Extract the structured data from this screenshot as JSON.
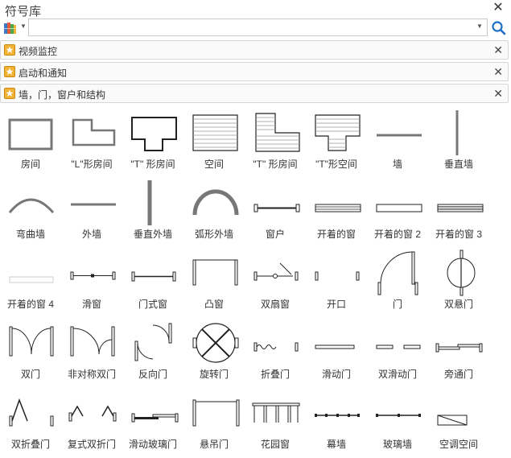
{
  "window": {
    "title": "符号库"
  },
  "search": {
    "value": "",
    "placeholder": ""
  },
  "libraries": [
    {
      "label": "视频监控"
    },
    {
      "label": "启动和通知"
    },
    {
      "label": "墙，门，窗户和结构"
    }
  ],
  "shapes": [
    "房间",
    "\"L\"形房间",
    "\"T\" 形房间",
    "空间",
    "\"T\" 形房间",
    "\"T\"形空间",
    "墙",
    "垂直墙",
    "弯曲墙",
    "外墙",
    "垂直外墙",
    "弧形外墙",
    "窗户",
    "开着的窗",
    "开着的窗 2",
    "开着的窗 3",
    "开着的窗 4",
    "滑窗",
    "门式窗",
    "凸窗",
    "双扇窗",
    "开口",
    "门",
    "双悬门",
    "双门",
    "非对称双门",
    "反向门",
    "旋转门",
    "折叠门",
    "滑动门",
    "双滑动门",
    "旁通门",
    "双折叠门",
    "复式双折门",
    "滑动玻璃门",
    "悬吊门",
    "花园窗",
    "幕墙",
    "玻璃墙",
    "空调空间"
  ],
  "icons": {
    "library": "library-books-icon",
    "search": "magnifier-icon",
    "star": "star-tile-icon",
    "close": "close-icon"
  },
  "colors": {
    "accent": "#1e6fc7",
    "star": "#f2b233",
    "wall": "#777777"
  }
}
